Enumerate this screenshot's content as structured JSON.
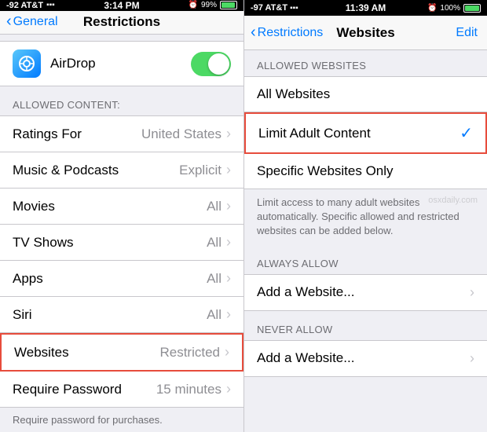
{
  "left": {
    "statusBar": {
      "carrier": "-92 AT&T",
      "signal": "▋▋▋▋",
      "wifi": "WiFi",
      "time": "3:14 PM",
      "battery_percent": "99%",
      "battery_icon": "battery"
    },
    "navBar": {
      "backLabel": "General",
      "title": "Restrictions"
    },
    "airdrop": {
      "label": "AirDrop",
      "toggleOn": true
    },
    "allowedContentLabel": "ALLOWED CONTENT:",
    "rows": [
      {
        "label": "Ratings For",
        "value": "United States",
        "highlighted": false
      },
      {
        "label": "Music & Podcasts",
        "value": "Explicit",
        "highlighted": false
      },
      {
        "label": "Movies",
        "value": "All",
        "highlighted": false
      },
      {
        "label": "TV Shows",
        "value": "All",
        "highlighted": false
      },
      {
        "label": "Apps",
        "value": "All",
        "highlighted": false
      },
      {
        "label": "Siri",
        "value": "All",
        "highlighted": false
      },
      {
        "label": "Websites",
        "value": "Restricted",
        "highlighted": true
      },
      {
        "label": "Require Password",
        "value": "15 minutes",
        "highlighted": false
      }
    ],
    "requirePasswordNote": "Require password for purchases."
  },
  "right": {
    "statusBar": {
      "carrier": "-97 AT&T",
      "time": "11:39 AM",
      "battery_percent": "100%"
    },
    "navBar": {
      "backLabel": "Restrictions",
      "title": "Websites",
      "editLabel": "Edit"
    },
    "allowedWebsitesLabel": "ALLOWED WEBSITES",
    "websiteOptions": [
      {
        "label": "All Websites",
        "checked": false,
        "highlighted": false
      },
      {
        "label": "Limit Adult Content",
        "checked": true,
        "highlighted": true
      },
      {
        "label": "Specific Websites Only",
        "checked": false,
        "highlighted": false
      }
    ],
    "description": "Limit access to many adult websites automatically. Specific allowed and restricted websites can be added below.",
    "alwaysAllowLabel": "ALWAYS ALLOW",
    "alwaysAllowRow": "Add a Website...",
    "neverAllowLabel": "NEVER ALLOW",
    "neverAllowRow": "Add a Website...",
    "watermark": "osxdaily.com"
  }
}
